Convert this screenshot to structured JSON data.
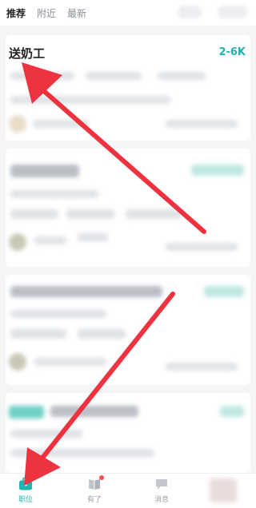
{
  "tabs": [
    {
      "label": "推荐",
      "active": true
    },
    {
      "label": "附近",
      "active": false
    },
    {
      "label": "最新",
      "active": false
    }
  ],
  "job_card": {
    "title": "送奶工",
    "salary": "2-6K"
  },
  "bottom_nav": [
    {
      "label": "职位",
      "icon": "briefcase-icon",
      "active": true
    },
    {
      "label": "有了",
      "icon": "book-icon",
      "active": false,
      "badge": true
    },
    {
      "label": "消息",
      "icon": "chat-icon",
      "active": false
    }
  ],
  "colors": {
    "accent": "#21b4b0",
    "arrow": "#ee3340",
    "badge": "#ff4d4f"
  }
}
